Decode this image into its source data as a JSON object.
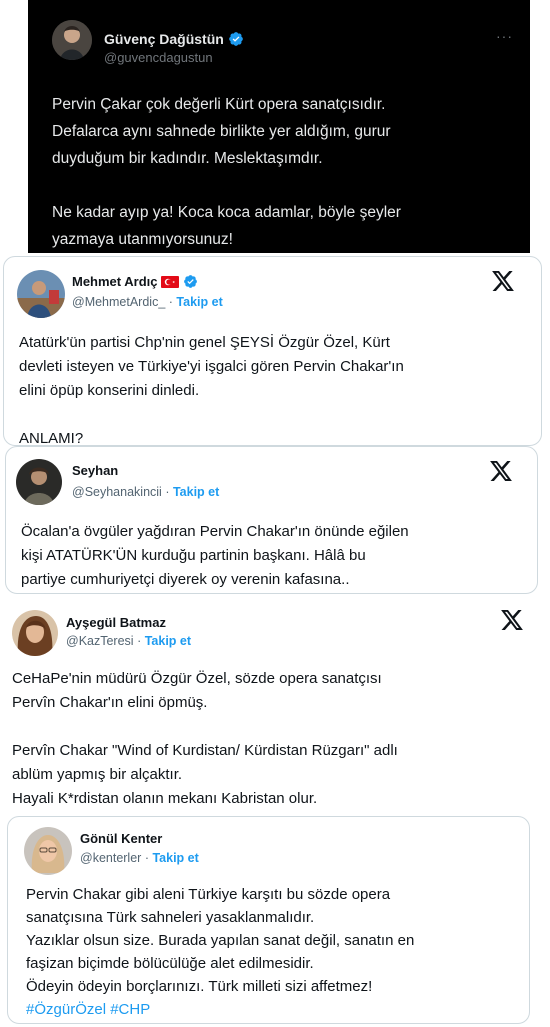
{
  "tweet1": {
    "name": "Güvenç Dağüstün",
    "handle": "@guvencdagustun",
    "lines": [
      "Pervin Çakar çok değerli Kürt opera sanatçısıdır.",
      "Defalarca aynı sahnede birlikte yer aldığım, gurur",
      "duyduğum bir kadındır. Meslektaşımdır.",
      "",
      "Ne kadar ayıp ya! Koca koca adamlar, böyle şeyler",
      "yazmaya utanmıyorsunuz!"
    ],
    "more_glyph": "···"
  },
  "tweet2": {
    "name": "Mehmet Ardıç",
    "handle": "@MehmetArdic_",
    "dot": "·",
    "follow": "Takip et",
    "lines": [
      "Atatürk'ün partisi Chp'nin genel ŞEYSİ Özgür Özel, Kürt",
      "devleti isteyen ve Türkiye'yi işgalci gören Pervin Chakar'ın",
      "elini öpüp konserini dinledi.",
      "",
      "ANLAMI?"
    ]
  },
  "tweet3": {
    "name": "Seyhan",
    "handle": "@Seyhanakincii",
    "dot": "·",
    "follow": "Takip et",
    "lines": [
      "Öcalan'a övgüler yağdıran Pervin Chakar'ın önünde eğilen",
      "kişi ATATÜRK'ÜN kurduğu partinin başkanı. Hâlâ bu",
      "partiye cumhuriyetçi diyerek oy verenin kafasına.."
    ]
  },
  "tweet4": {
    "name": "Ayşegül Batmaz",
    "handle": "@KazTeresi",
    "dot": "·",
    "follow": "Takip et",
    "lines": [
      "CeHaPe'nin müdürü Özgür Özel, sözde opera sanatçısı",
      "Pervîn Chakar'ın elini öpmüş.",
      "",
      "Pervîn Chakar \"Wind of Kurdistan/ Kürdistan Rüzgarı\" adlı",
      "ablüm yapmış bir alçaktır.",
      "Hayali K*rdistan olanın mekanı Kabristan olur."
    ]
  },
  "tweet5": {
    "name": "Gönül Kenter",
    "handle": "@kenterler",
    "dot": "·",
    "follow": "Takip et",
    "lines": [
      "Pervin Chakar gibi aleni Türkiye karşıtı bu sözde opera",
      "sanatçısına Türk sahneleri yasaklanmalıdır.",
      "Yazıklar olsun size. Burada yapılan sanat değil, sanatın en",
      "faşizan biçimde bölücülüğe alet edilmesidir.",
      "Ödeyin ödeyin borçlarınızı. Türk milleti sizi affetmez!"
    ],
    "hashtags": [
      "#ÖzgürÖzel",
      "#CHP"
    ]
  },
  "colors": {
    "dark_bg": "#000000",
    "verified_blue": "#1d9bf0",
    "follow_blue": "#1d9bf0",
    "handle_gray": "#536471",
    "border_gray": "#cfd9de"
  },
  "icons": {
    "verified": "verified-badge-icon",
    "x_logo": "x-logo-icon",
    "flag": "turkey-flag-icon",
    "more": "more-options-icon"
  }
}
